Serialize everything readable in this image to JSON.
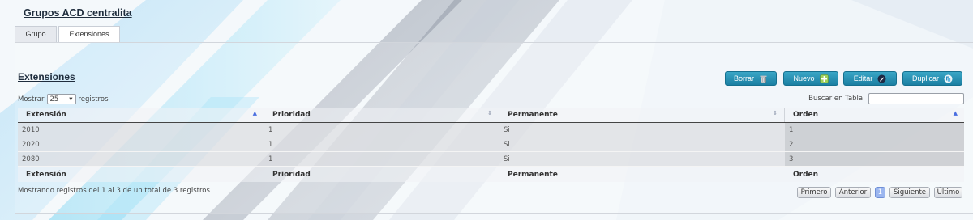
{
  "page": {
    "title": "Grupos ACD centralita"
  },
  "tabs": [
    {
      "label": "Grupo",
      "active": false
    },
    {
      "label": "Extensiones",
      "active": true
    }
  ],
  "section": {
    "title": "Extensiones"
  },
  "toolbar": {
    "buttons": [
      {
        "label": "Borrar",
        "icon": "trash-icon"
      },
      {
        "label": "Nuevo",
        "icon": "add-icon"
      },
      {
        "label": "Editar",
        "icon": "edit-icon"
      },
      {
        "label": "Duplicar",
        "icon": "duplicate-icon"
      }
    ],
    "button_color": "#2591b3"
  },
  "table": {
    "length_prefix": "Mostrar",
    "length_value": "25",
    "length_suffix": "registros",
    "search_label": "Buscar en Tabla:",
    "columns": [
      "Extensión",
      "Prioridad",
      "Permanente",
      "Orden"
    ],
    "rows": [
      [
        "2010",
        "1",
        "Si",
        "1"
      ],
      [
        "2020",
        "1",
        "Si",
        "2"
      ],
      [
        "2080",
        "1",
        "Si",
        "3"
      ]
    ],
    "info": "Mostrando registros del 1 al 3 de un total de 3 registros",
    "pagination": {
      "first": "Primero",
      "previous": "Anterior",
      "current": "1",
      "next": "Siguiente",
      "last": "Último"
    }
  }
}
